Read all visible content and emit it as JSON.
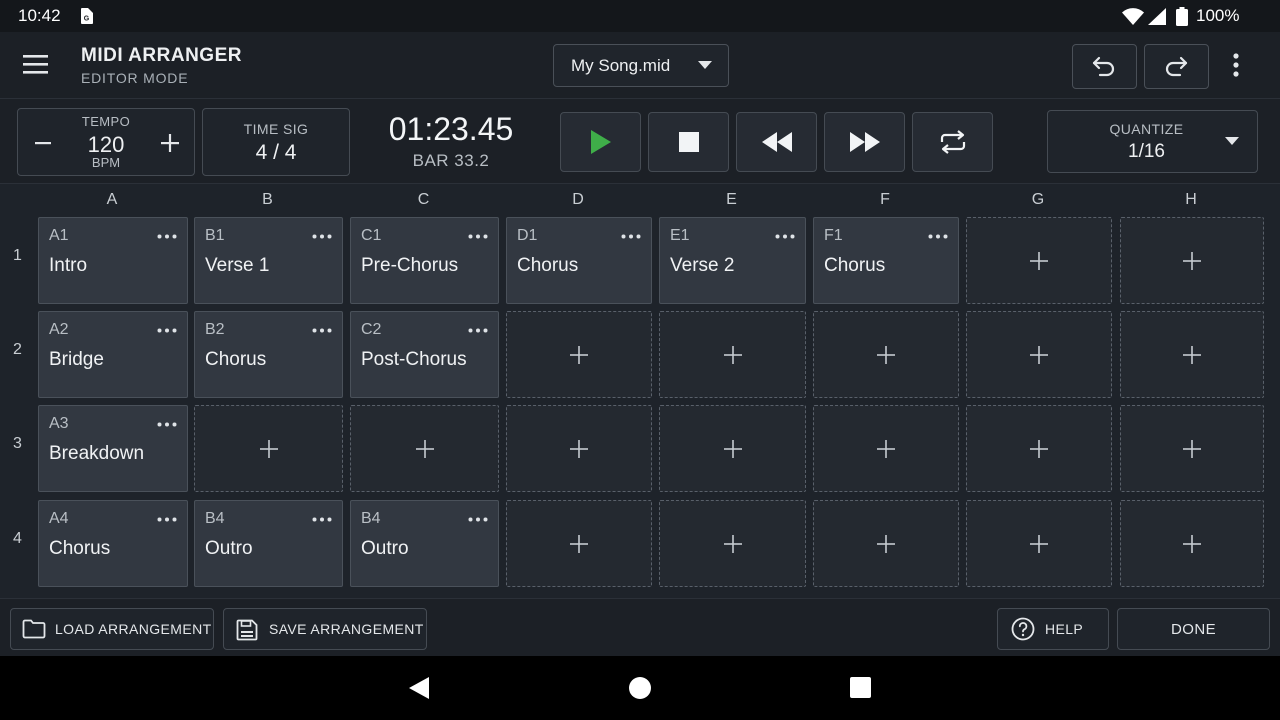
{
  "status_bar": {
    "time": "10:42",
    "battery": "100%"
  },
  "app_bar": {
    "title": "MIDI ARRANGER",
    "subtitle": "EDITOR MODE",
    "file_name": "My Song.mid"
  },
  "transport": {
    "tempo_label": "TEMPO",
    "tempo_value": "120",
    "tempo_unit": "BPM",
    "time_sig_label": "TIME SIG",
    "time_sig_value": "4 / 4",
    "clock": "01:23.45",
    "bar": "BAR 33.2",
    "quantize_label": "QUANTIZE",
    "quantize_value": "1/16"
  },
  "grid": {
    "columns": [
      "A",
      "B",
      "C",
      "D",
      "E",
      "F",
      "G",
      "H"
    ],
    "rows": [
      "1",
      "2",
      "3",
      "4"
    ],
    "cells": [
      [
        {
          "id": "A1",
          "name": "Intro"
        },
        {
          "id": "B1",
          "name": "Verse 1"
        },
        {
          "id": "C1",
          "name": "Pre-Chorus"
        },
        {
          "id": "D1",
          "name": "Chorus"
        },
        {
          "id": "E1",
          "name": "Verse 2"
        },
        {
          "id": "F1",
          "name": "Chorus"
        },
        null,
        null
      ],
      [
        {
          "id": "A2",
          "name": "Bridge"
        },
        {
          "id": "B2",
          "name": "Chorus"
        },
        {
          "id": "C2",
          "name": "Post-Chorus"
        },
        null,
        null,
        null,
        null,
        null
      ],
      [
        {
          "id": "A3",
          "name": "Breakdown"
        },
        null,
        null,
        null,
        null,
        null,
        null,
        null
      ],
      [
        {
          "id": "A4",
          "name": "Chorus"
        },
        {
          "id": "B4",
          "name": "Outro"
        },
        {
          "id": "B4",
          "name": "Outro"
        },
        null,
        null,
        null,
        null,
        null
      ]
    ]
  },
  "footer": {
    "load_label": "LOAD ARRANGEMENT",
    "save_label": "SAVE ARRANGEMENT",
    "help_label": "HELP",
    "done_label": "DONE"
  },
  "colors": {
    "play_green": "#3fae49",
    "background": "#1e232a",
    "clip_fill": "#323841"
  },
  "icons": {
    "menu": "hamburger-icon",
    "undo": "undo-icon",
    "redo": "redo-icon",
    "more": "more-vert-icon",
    "play": "play-icon",
    "stop": "stop-icon",
    "rewind": "rewind-icon",
    "fast_forward": "fast-forward-icon",
    "loop": "loop-icon",
    "folder": "folder-icon",
    "save": "save-icon",
    "help": "help-icon"
  }
}
